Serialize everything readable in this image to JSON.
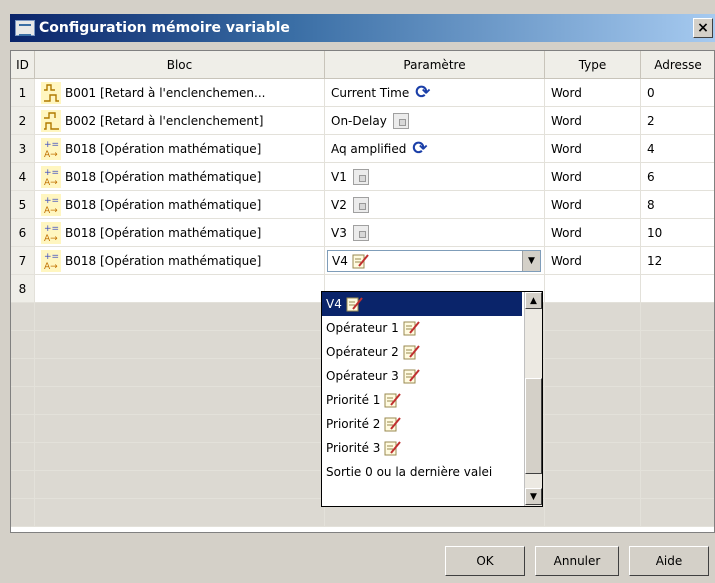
{
  "window": {
    "title": "Configuration mémoire variable",
    "close_label": "×"
  },
  "columns": {
    "id": "ID",
    "bloc": "Bloc",
    "param": "Paramètre",
    "type": "Type",
    "addr": "Adresse"
  },
  "rows": [
    {
      "id": "1",
      "bloc": "B001 [Retard à l'enclenchemen...",
      "param": "Current Time",
      "type": "Word",
      "addr": "0",
      "block_icon": "on-delay-icon",
      "param_icon": "refresh-icon"
    },
    {
      "id": "2",
      "bloc": "B002 [Retard à l'enclenchement]",
      "param": "On-Delay",
      "type": "Word",
      "addr": "2",
      "block_icon": "off-delay-icon",
      "param_icon": "lock-icon"
    },
    {
      "id": "3",
      "bloc": "B018 [Opération mathématique]",
      "param": "Aq amplified",
      "type": "Word",
      "addr": "4",
      "block_icon": "math-icon",
      "param_icon": "refresh-icon"
    },
    {
      "id": "4",
      "bloc": "B018 [Opération mathématique]",
      "param": "V1",
      "type": "Word",
      "addr": "6",
      "block_icon": "math-icon",
      "param_icon": "lock-icon"
    },
    {
      "id": "5",
      "bloc": "B018 [Opération mathématique]",
      "param": "V2",
      "type": "Word",
      "addr": "8",
      "block_icon": "math-icon",
      "param_icon": "lock-icon"
    },
    {
      "id": "6",
      "bloc": "B018 [Opération mathématique]",
      "param": "V3",
      "type": "Word",
      "addr": "10",
      "block_icon": "math-icon",
      "param_icon": "lock-icon"
    },
    {
      "id": "7",
      "bloc": "B018 [Opération mathématique]",
      "param": "V4",
      "type": "Word",
      "addr": "12",
      "block_icon": "math-icon",
      "param_icon": "edit-icon"
    },
    {
      "id": "8"
    }
  ],
  "dropdown": {
    "options": [
      "V4",
      "Opérateur 1",
      "Opérateur 2",
      "Opérateur 3",
      "Priorité 1",
      "Priorité 2",
      "Priorité 3",
      "Sortie 0 ou la dernière valei"
    ],
    "selected": "V4"
  },
  "buttons": {
    "ok": "OK",
    "cancel": "Annuler",
    "help": "Aide"
  },
  "colors": {
    "titlebar": "#0a246a",
    "selection": "#0a246a",
    "refresh": "#1b3fa8",
    "window_bg": "#d4d0c8"
  }
}
